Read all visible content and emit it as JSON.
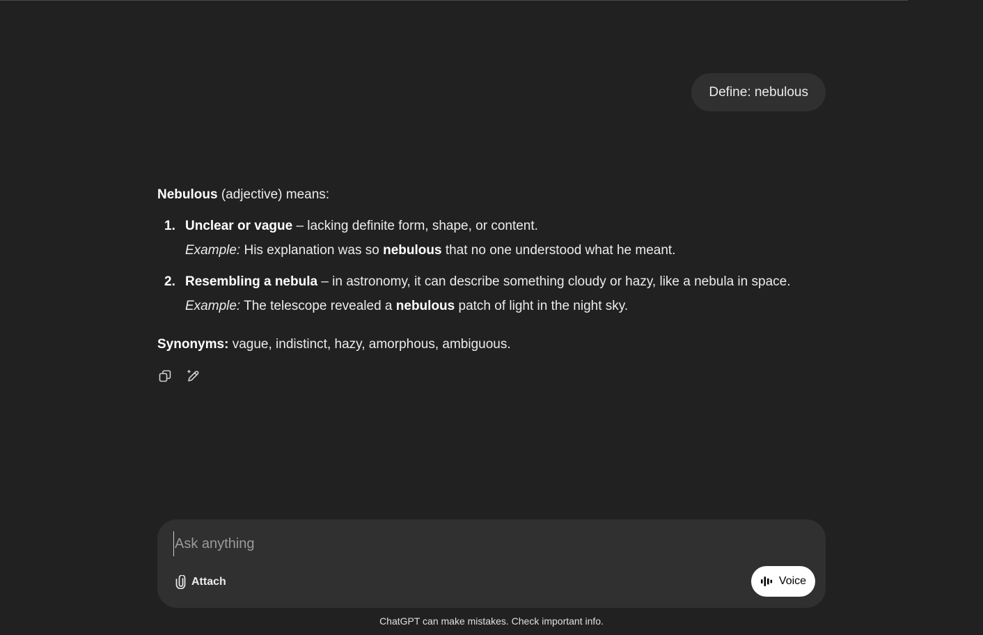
{
  "user_message": "Define: nebulous",
  "response": {
    "intro_term": "Nebulous",
    "intro_rest": " (adjective) means:",
    "items": [
      {
        "num": "1.",
        "term": "Unclear or vague",
        "definition": " – lacking definite form, shape, or content.",
        "example_label": "Example:",
        "example_before": " His explanation was so ",
        "example_bold": "nebulous",
        "example_after": " that no one understood what he meant."
      },
      {
        "num": "2.",
        "term": "Resembling a nebula",
        "definition": " – in astronomy, it can describe something cloudy or hazy, like a nebula in space.",
        "example_label": "Example:",
        "example_before": " The telescope revealed a ",
        "example_bold": "nebulous",
        "example_after": " patch of light in the night sky."
      }
    ],
    "synonyms_label": "Synonyms:",
    "synonyms_text": " vague, indistinct, hazy, amorphous, ambiguous."
  },
  "actions": {
    "copy_icon": "copy-icon",
    "edit_icon": "pencil-sparkle-icon"
  },
  "composer": {
    "placeholder": "Ask anything",
    "value": "",
    "attach_label": "Attach",
    "voice_label": "Voice"
  },
  "disclaimer": "ChatGPT can make mistakes. Check important info.",
  "colors": {
    "background": "#212121",
    "bubble": "#303030",
    "text": "#ececec",
    "voice_button": "#ffffff"
  }
}
